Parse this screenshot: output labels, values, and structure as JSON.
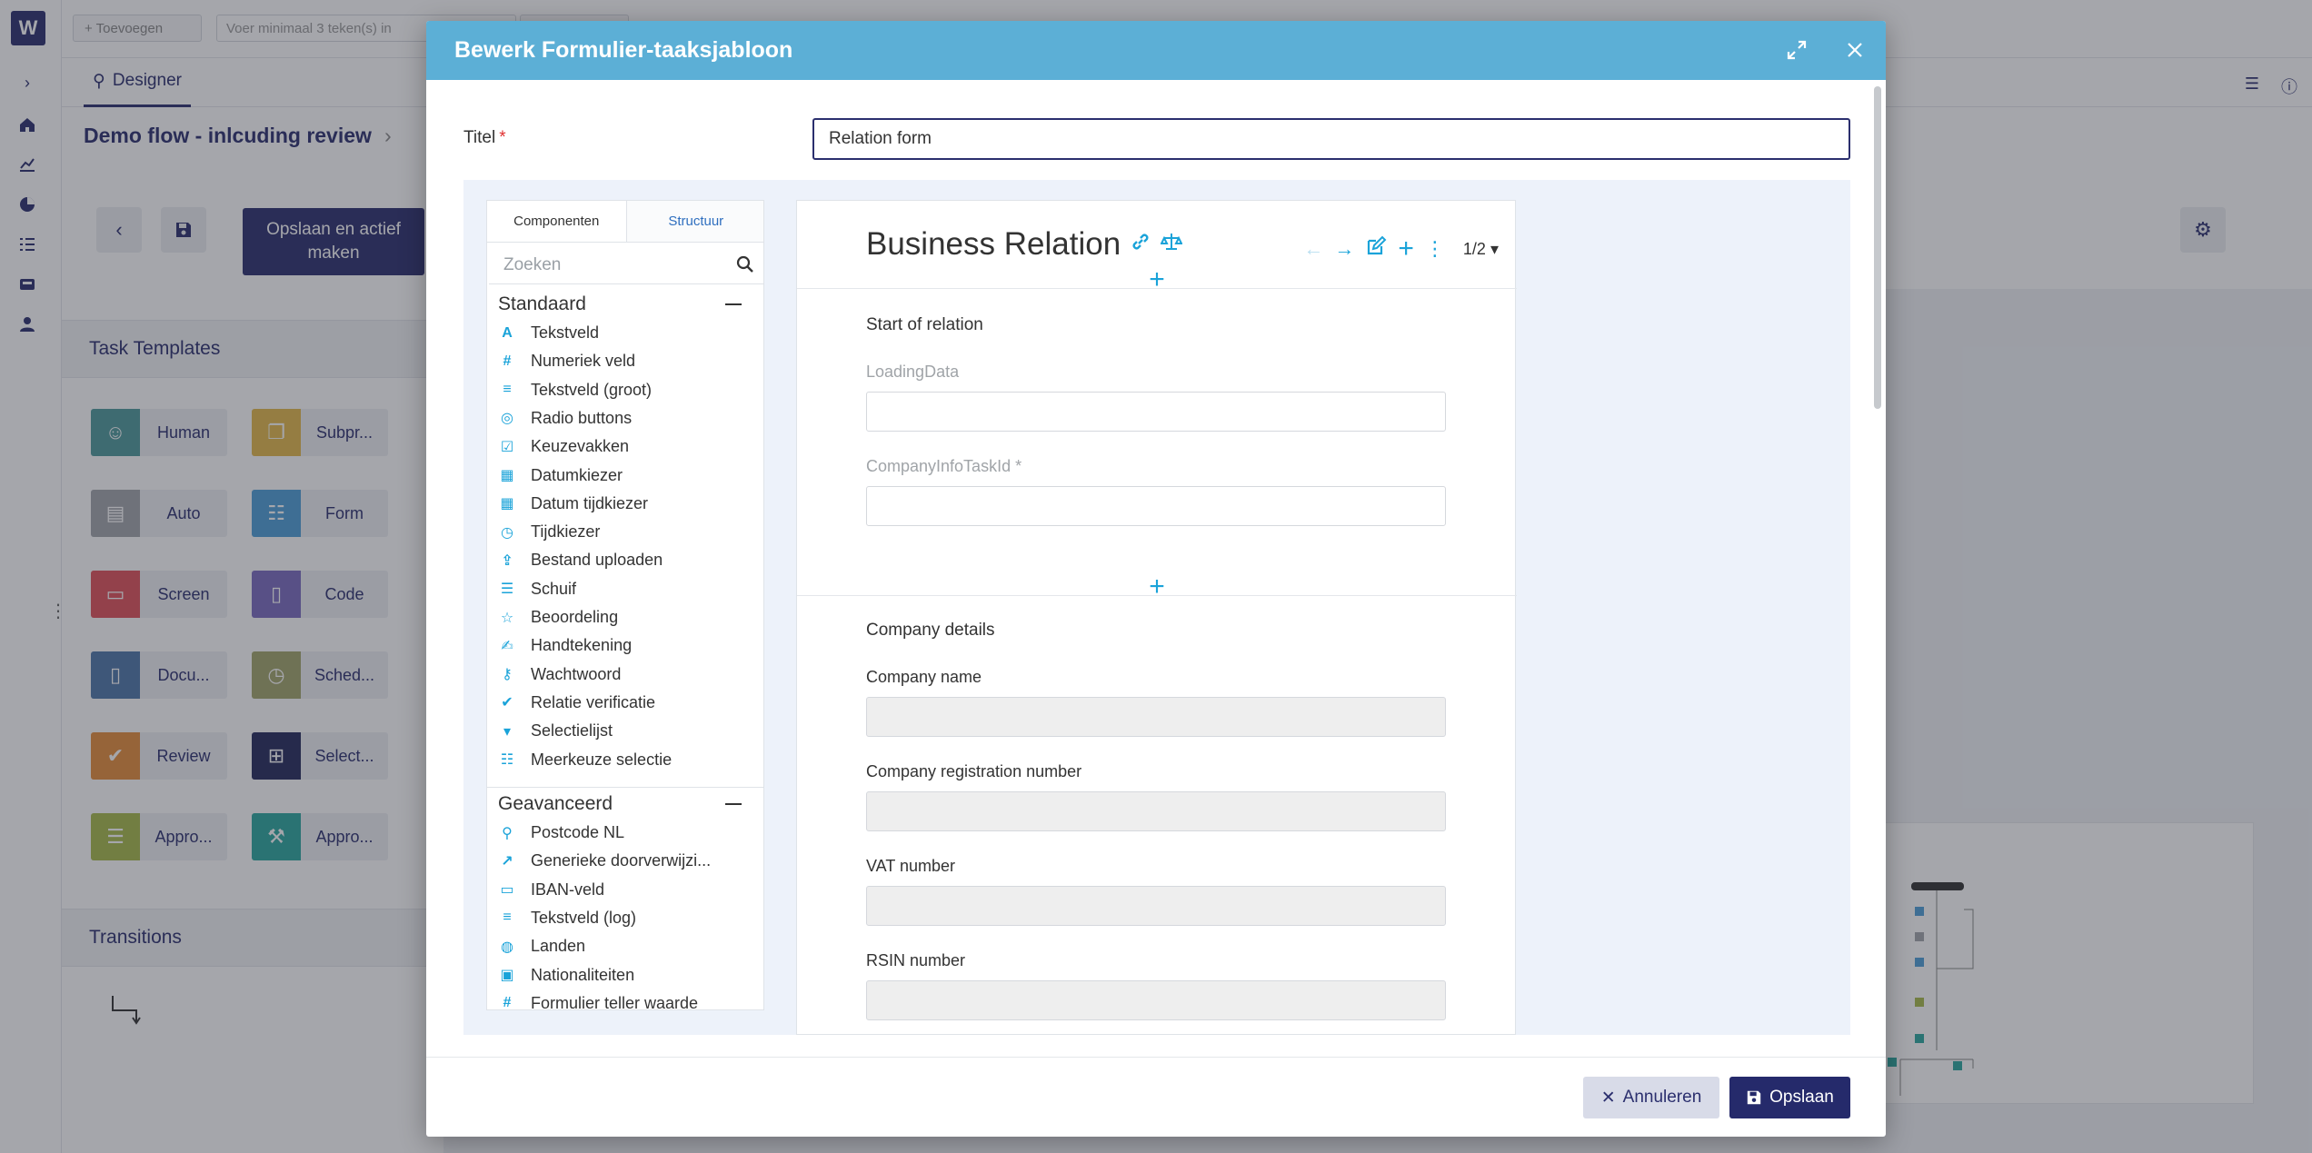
{
  "app": {
    "logo": "W",
    "add_button": "+ Toevoegen",
    "search_placeholder": "Voer minimaal 3 teken(s) in",
    "tab_designer": "Designer",
    "flow_title": "Demo flow - inlcuding review",
    "activate_button": "Opslaan en actief maken",
    "task_templates_header": "Task Templates",
    "transitions_header": "Transitions",
    "templates": [
      {
        "label": "Human",
        "color": "#4f9a9c",
        "icon": "person-icon"
      },
      {
        "label": "Subpr...",
        "color": "#e3b94b",
        "icon": "subprocess-icon"
      },
      {
        "label": "Auto",
        "color": "#a2a6ab",
        "icon": "auto-icon"
      },
      {
        "label": "Form",
        "color": "#4f9fd8",
        "icon": "form-icon"
      },
      {
        "label": "Screen",
        "color": "#e0525a",
        "icon": "screen-icon"
      },
      {
        "label": "Code",
        "color": "#7b6bc0",
        "icon": "code-icon"
      },
      {
        "label": "Docu...",
        "color": "#4f77a9",
        "icon": "document-icon"
      },
      {
        "label": "Sched...",
        "color": "#a3a56b",
        "icon": "clock-icon"
      },
      {
        "label": "Review",
        "color": "#e58d3c",
        "icon": "review-icon"
      },
      {
        "label": "Select...",
        "color": "#252a5c",
        "icon": "grid-icon"
      },
      {
        "label": "Appro...",
        "color": "#a8ba4b",
        "icon": "approve-list-icon"
      },
      {
        "label": "Appro...",
        "color": "#2ba79f",
        "icon": "gavel-icon"
      }
    ]
  },
  "modal": {
    "title": "Bewerk Formulier-taaksjabloon",
    "title_label": "Titel",
    "required_mark": "*",
    "title_value": "Relation form",
    "palette": {
      "tab_components": "Componenten",
      "tab_structure": "Structuur",
      "search_placeholder": "Zoeken",
      "group_standard": "Standaard",
      "group_advanced": "Geavanceerd",
      "standard_items": [
        {
          "label": "Tekstveld",
          "icon": "text-A-icon"
        },
        {
          "label": "Numeriek veld",
          "icon": "hash-icon"
        },
        {
          "label": "Tekstveld (groot)",
          "icon": "lines-icon"
        },
        {
          "label": "Radio buttons",
          "icon": "radio-icon"
        },
        {
          "label": "Keuzevakken",
          "icon": "checkbox-icon"
        },
        {
          "label": "Datumkiezer",
          "icon": "calendar-icon"
        },
        {
          "label": "Datum tijdkiezer",
          "icon": "calendar-clock-icon"
        },
        {
          "label": "Tijdkiezer",
          "icon": "clock-icon"
        },
        {
          "label": "Bestand uploaden",
          "icon": "upload-icon"
        },
        {
          "label": "Schuif",
          "icon": "slider-icon"
        },
        {
          "label": "Beoordeling",
          "icon": "star-icon"
        },
        {
          "label": "Handtekening",
          "icon": "signature-icon"
        },
        {
          "label": "Wachtwoord",
          "icon": "key-icon"
        },
        {
          "label": "Relatie verificatie",
          "icon": "user-check-icon"
        },
        {
          "label": "Selectielijst",
          "icon": "caret-down-icon"
        },
        {
          "label": "Meerkeuze selectie",
          "icon": "list-check-icon"
        }
      ],
      "advanced_items": [
        {
          "label": "Postcode NL",
          "icon": "pin-icon"
        },
        {
          "label": "Generieke doorverwijzi...",
          "icon": "external-link-icon"
        },
        {
          "label": "IBAN-veld",
          "icon": "card-icon"
        },
        {
          "label": "Tekstveld (log)",
          "icon": "lines-icon"
        },
        {
          "label": "Landen",
          "icon": "globe-icon"
        },
        {
          "label": "Nationaliteiten",
          "icon": "passport-icon"
        },
        {
          "label": "Formulier teller waarde",
          "icon": "hash-icon"
        }
      ]
    },
    "form": {
      "title": "Business Relation",
      "pager": "1/2",
      "section1": "Start of relation",
      "field_loading": "LoadingData",
      "field_companyinfo": "CompanyInfoTaskId *",
      "section2": "Company details",
      "field_company_name": "Company name",
      "field_company_reg": "Company registration number",
      "field_vat": "VAT number",
      "field_rsin": "RSIN number"
    },
    "cancel_label": "Annuleren",
    "save_label": "Opslaan"
  }
}
